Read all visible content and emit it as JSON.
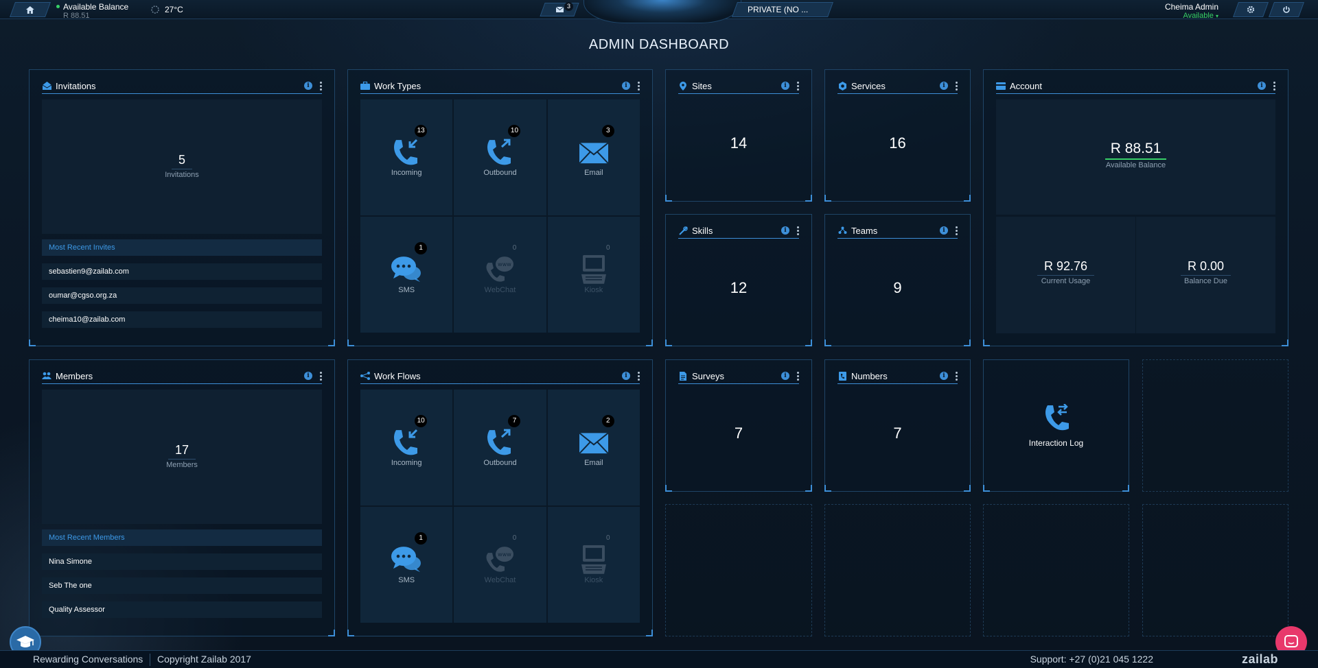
{
  "topbar": {
    "balance_label": "Available Balance",
    "balance_value": "R 88.51",
    "temperature": "27°C",
    "mail_count": "3",
    "organisation": "PRIVATE (NO ...",
    "user_name": "Cheima Admin",
    "user_status": "Available",
    "status_color": "#37d067"
  },
  "page_title": "ADMIN DASHBOARD",
  "invitations": {
    "title": "Invitations",
    "count": "5",
    "count_label": "Invitations",
    "list_title": "Most Recent Invites",
    "items": [
      "sebastien9@zailab.com",
      "oumar@cgso.org.za",
      "cheima10@zailab.com"
    ]
  },
  "members": {
    "title": "Members",
    "count": "17",
    "count_label": "Members",
    "list_title": "Most Recent Members",
    "items": [
      "Nina Simone",
      "Seb The one",
      "Quality Assessor"
    ]
  },
  "work_types": {
    "title": "Work Types",
    "tiles": [
      {
        "label": "Incoming",
        "count": "13",
        "icon": "incoming-call-icon"
      },
      {
        "label": "Outbound",
        "count": "10",
        "icon": "outbound-call-icon"
      },
      {
        "label": "Email",
        "count": "3",
        "icon": "email-icon"
      },
      {
        "label": "SMS",
        "count": "1",
        "icon": "sms-icon"
      },
      {
        "label": "WebChat",
        "count": "0",
        "icon": "webchat-icon"
      },
      {
        "label": "Kiosk",
        "count": "0",
        "icon": "kiosk-icon"
      }
    ]
  },
  "work_flows": {
    "title": "Work Flows",
    "tiles": [
      {
        "label": "Incoming",
        "count": "10",
        "icon": "incoming-call-icon"
      },
      {
        "label": "Outbound",
        "count": "7",
        "icon": "outbound-call-icon"
      },
      {
        "label": "Email",
        "count": "2",
        "icon": "email-icon"
      },
      {
        "label": "SMS",
        "count": "1",
        "icon": "sms-icon"
      },
      {
        "label": "WebChat",
        "count": "0",
        "icon": "webchat-icon"
      },
      {
        "label": "Kiosk",
        "count": "0",
        "icon": "kiosk-icon"
      }
    ]
  },
  "sites": {
    "title": "Sites",
    "count": "14"
  },
  "services": {
    "title": "Services",
    "count": "16"
  },
  "skills": {
    "title": "Skills",
    "count": "12"
  },
  "teams": {
    "title": "Teams",
    "count": "9"
  },
  "surveys": {
    "title": "Surveys",
    "count": "7"
  },
  "numbers": {
    "title": "Numbers",
    "count": "7"
  },
  "account": {
    "title": "Account",
    "available_balance": "R 88.51",
    "available_balance_label": "Available Balance",
    "current_usage": "R 92.76",
    "current_usage_label": "Current Usage",
    "balance_due": "R 0.00",
    "balance_due_label": "Balance Due"
  },
  "interaction_log": {
    "label": "Interaction Log"
  },
  "footer": {
    "tagline": "Rewarding Conversations",
    "copyright": "Copyright Zailab 2017",
    "support": "Support: +27 (0)21 045 1222",
    "brand": "zailab"
  },
  "colors": {
    "accent": "#3d9ae8",
    "available": "#37d067",
    "chat": "#e8386b"
  }
}
